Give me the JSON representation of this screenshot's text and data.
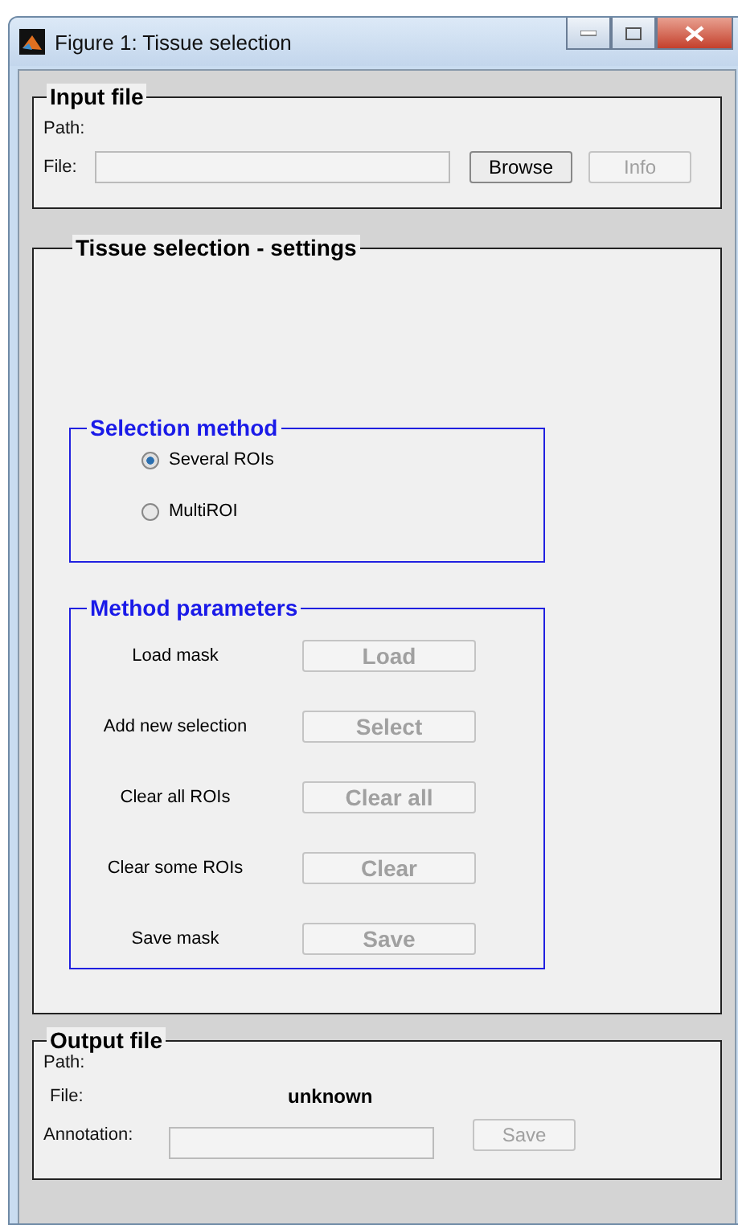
{
  "window": {
    "title": "Figure 1: Tissue selection"
  },
  "input_file": {
    "title": "Input file",
    "path_label": "Path:",
    "file_label": "File:",
    "buttons": [
      {
        "label": "Browse",
        "disabled": false
      },
      {
        "label": "Info",
        "disabled": true
      }
    ]
  },
  "settings": {
    "title": "Tissue selection - settings",
    "selection_method": {
      "title": "Selection method",
      "options": [
        {
          "label": "Several ROIs",
          "selected": true
        },
        {
          "label": "MultiROI",
          "selected": false
        }
      ]
    },
    "method_parameters": {
      "title": "Method parameters",
      "rows": [
        {
          "label": "Load mask",
          "button": "Load",
          "disabled": true
        },
        {
          "label": "Add new selection",
          "button": "Select",
          "disabled": true
        },
        {
          "label": "Clear all ROIs",
          "button": "Clear all",
          "disabled": true
        },
        {
          "label": "Clear some ROIs",
          "button": "Clear",
          "disabled": true
        },
        {
          "label": "Save mask",
          "button": "Save",
          "disabled": true
        }
      ]
    }
  },
  "output_file": {
    "title": "Output file",
    "path_label": "Path:",
    "file_label": "File:",
    "file_value": "unknown",
    "annotation_label": "Annotation:",
    "button": {
      "label": "Save",
      "disabled": true
    }
  }
}
